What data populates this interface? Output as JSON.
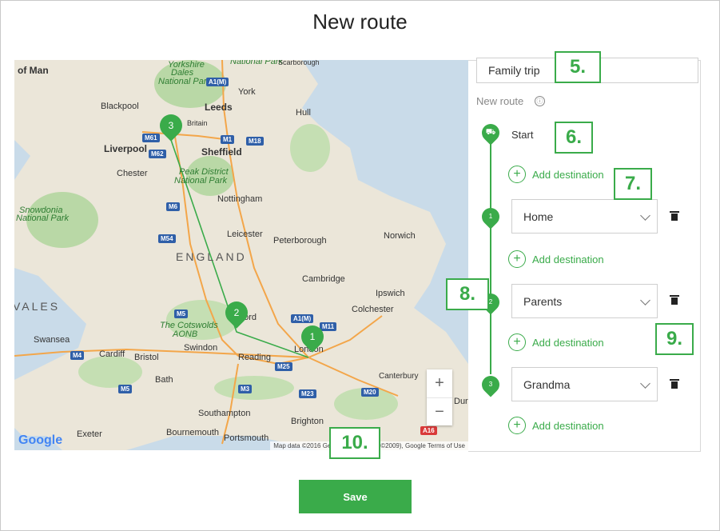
{
  "page_title": "New route",
  "route_name": {
    "value": "Family trip"
  },
  "panel": {
    "subtitle": "New route",
    "info_icon": "ⓘ",
    "start_label": "Start",
    "add_destination": "Add destination",
    "stops": [
      {
        "number": "1",
        "value": "Home"
      },
      {
        "number": "2",
        "value": "Parents"
      },
      {
        "number": "3",
        "value": "Grandma"
      }
    ]
  },
  "callouts": [
    "5.",
    "6.",
    "7.",
    "8.",
    "9.",
    "10."
  ],
  "map": {
    "markers": [
      "1",
      "2",
      "3"
    ],
    "labels": {
      "of_man": "of Man",
      "yorkshire": "Yorkshire",
      "dales": "Dales",
      "national_park": "National Park",
      "national_park_top": "National Park",
      "scarborough": "Scarborough",
      "york": "York",
      "blackpool": "Blackpool",
      "leeds": "Leeds",
      "hull": "Hull",
      "britain": "Britain",
      "liverpool": "Liverpool",
      "sheffield": "Sheffield",
      "chester": "Chester",
      "peak_district": "Peak District",
      "national_park_2": "National Park",
      "nottingham": "Nottingham",
      "snowdonia": "Snowdonia",
      "national_park_3": "National Park",
      "leicester": "Leicester",
      "peterborough": "Peterborough",
      "norwich": "Norwich",
      "england": "ENGLAND",
      "cambridge": "Cambridge",
      "ipswich": "Ipswich",
      "wales": "VALES",
      "colchester": "Colchester",
      "cotswolds": "The Cotswolds",
      "aonb": "AONB",
      "oxford": "Oxford",
      "swansea": "Swansea",
      "swindon": "Swindon",
      "cardiff": "Cardiff",
      "bristol": "Bristol",
      "reading": "Reading",
      "london": "London",
      "canterbury": "Canterbury",
      "bath": "Bath",
      "southampton": "Southampton",
      "brighton": "Brighton",
      "bournemouth": "Bournemouth",
      "portsmouth": "Portsmouth",
      "exeter": "Exeter",
      "dur": "Dur"
    },
    "roads": [
      "A1(M)",
      "M61",
      "M62",
      "M1",
      "M18",
      "M6",
      "M54",
      "M5",
      "A1(M)",
      "M11",
      "M4",
      "M25",
      "M3",
      "M23",
      "M20",
      "M5",
      "A16"
    ],
    "zoom_in": "+",
    "zoom_out": "−",
    "google_logo": "Google",
    "attribution": "Map data ©2016 GeoBasis-DE/BKG (©2009), Google   Terms of Use"
  },
  "save_label": "Save",
  "colors": {
    "accent": "#3aab4a",
    "water": "#c9dbe9",
    "land": "#e9e4d8"
  }
}
